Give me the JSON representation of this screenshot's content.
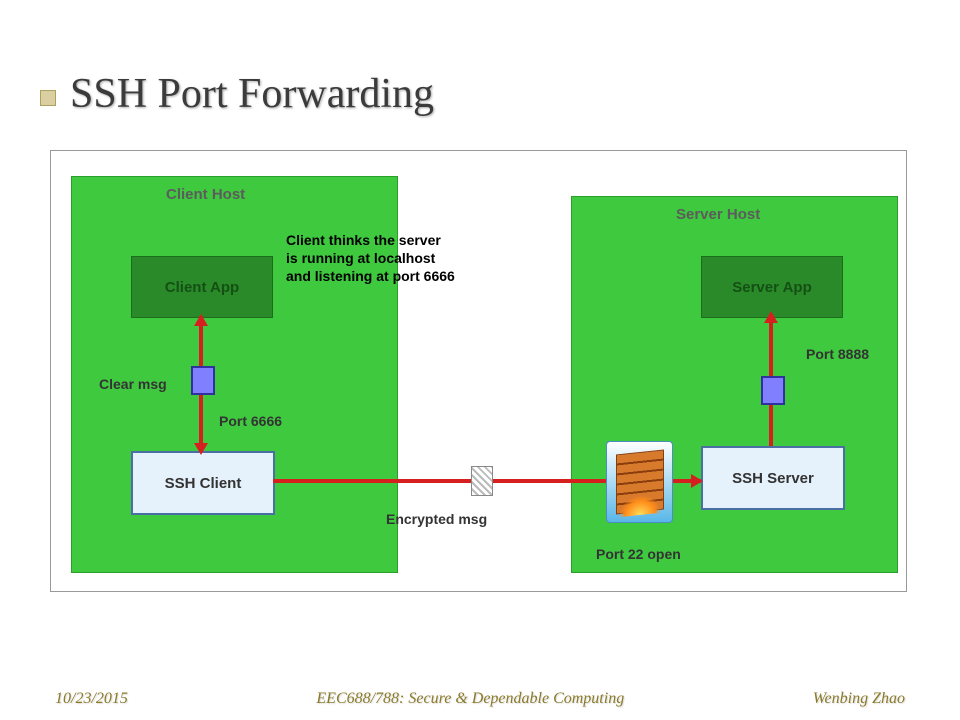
{
  "title": "SSH Port Forwarding",
  "hosts": {
    "client_label": "Client Host",
    "server_label": "Server  Host"
  },
  "boxes": {
    "client_app": "Client App",
    "server_app": "Server App",
    "ssh_client": "SSH Client",
    "ssh_server": "SSH Server"
  },
  "labels": {
    "clear_msg": "Clear msg",
    "port6666": "Port 6666",
    "port8888": "Port 8888",
    "encrypted": "Encrypted msg",
    "port22": "Port 22 open"
  },
  "annotation": "Client thinks the server is running at localhost and listening at port 6666",
  "footer": {
    "date": "10/23/2015",
    "course": "EEC688/788: Secure & Dependable Computing",
    "author": "Wenbing Zhao"
  }
}
